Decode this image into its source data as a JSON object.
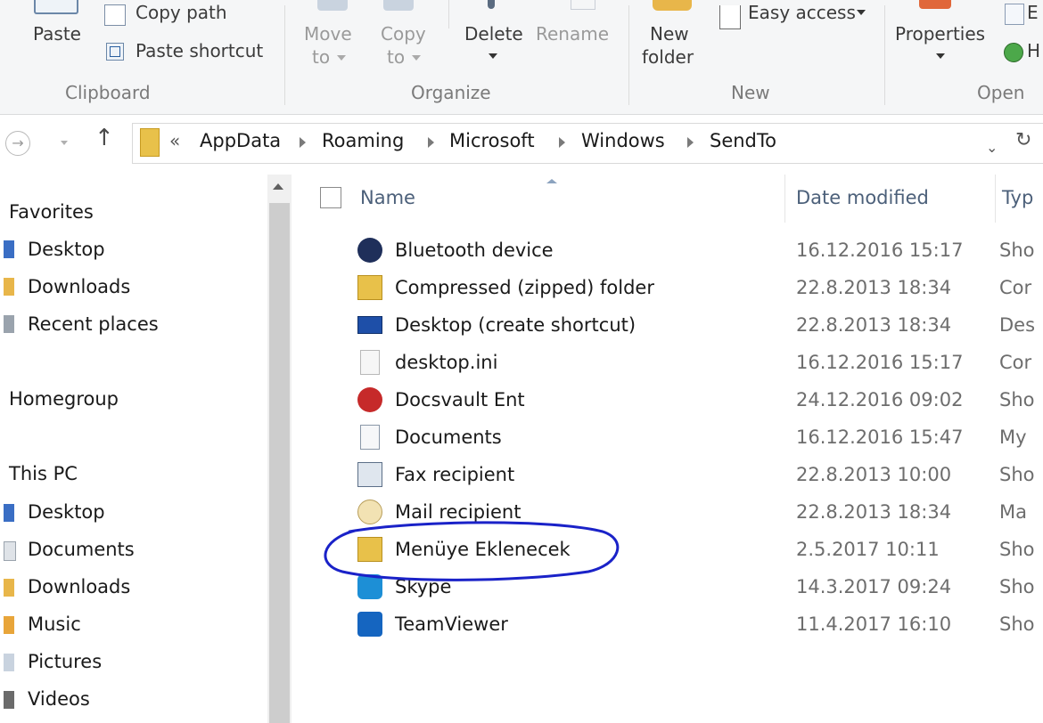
{
  "ribbon": {
    "clipboard": {
      "paste": "Paste",
      "copy_path": "Copy path",
      "paste_shortcut": "Paste shortcut",
      "group": "Clipboard"
    },
    "organize": {
      "move_to": "Move",
      "move_to2": "to",
      "copy_to": "Copy",
      "copy_to2": "to",
      "delete": "Delete",
      "rename": "Rename",
      "group": "Organize"
    },
    "new": {
      "new_folder": "New",
      "new_folder2": "folder",
      "easy_access": "Easy access",
      "group": "New"
    },
    "open": {
      "properties": "Properties",
      "group": "Open"
    }
  },
  "address": {
    "crumbs": [
      "AppData",
      "Roaming",
      "Microsoft",
      "Windows",
      "SendTo"
    ],
    "overflow": "«"
  },
  "nav": {
    "favorites": {
      "label": "Favorites",
      "items": [
        "Desktop",
        "Downloads",
        "Recent places"
      ]
    },
    "homegroup": "Homegroup",
    "thispc": {
      "label": "This PC",
      "items": [
        "Desktop",
        "Documents",
        "Downloads",
        "Music",
        "Pictures",
        "Videos"
      ]
    }
  },
  "columns": {
    "name": "Name",
    "date": "Date modified",
    "type": "Typ"
  },
  "files": [
    {
      "name": "Bluetooth device",
      "date": "16.12.2016 15:17",
      "type": "Sho",
      "icon": "bluetooth-icon"
    },
    {
      "name": "Compressed (zipped) folder",
      "date": "22.8.2013 18:34",
      "type": "Cor",
      "icon": "zip-folder-icon"
    },
    {
      "name": "Desktop (create shortcut)",
      "date": "22.8.2013 18:34",
      "type": "Des",
      "icon": "desktop-icon"
    },
    {
      "name": "desktop.ini",
      "date": "16.12.2016 15:17",
      "type": "Cor",
      "icon": "ini-file-icon"
    },
    {
      "name": "Docsvault Ent",
      "date": "24.12.2016 09:02",
      "type": "Sho",
      "icon": "docsvault-icon"
    },
    {
      "name": "Documents",
      "date": "16.12.2016 15:47",
      "type": "My",
      "icon": "documents-icon"
    },
    {
      "name": "Fax recipient",
      "date": "22.8.2013 10:00",
      "type": "Sho",
      "icon": "fax-icon"
    },
    {
      "name": "Mail recipient",
      "date": "22.8.2013 18:34",
      "type": "Ma",
      "icon": "mail-icon"
    },
    {
      "name": "Menüye Eklenecek",
      "date": "2.5.2017 10:11",
      "type": "Sho",
      "icon": "folder-shortcut-icon"
    },
    {
      "name": "Skype",
      "date": "14.3.2017 09:24",
      "type": "Sho",
      "icon": "skype-icon"
    },
    {
      "name": "TeamViewer",
      "date": "11.4.2017 16:10",
      "type": "Sho",
      "icon": "teamviewer-icon"
    }
  ],
  "colors": {
    "highlight_circle": "#1a22c8",
    "header_text": "#4c607a"
  }
}
